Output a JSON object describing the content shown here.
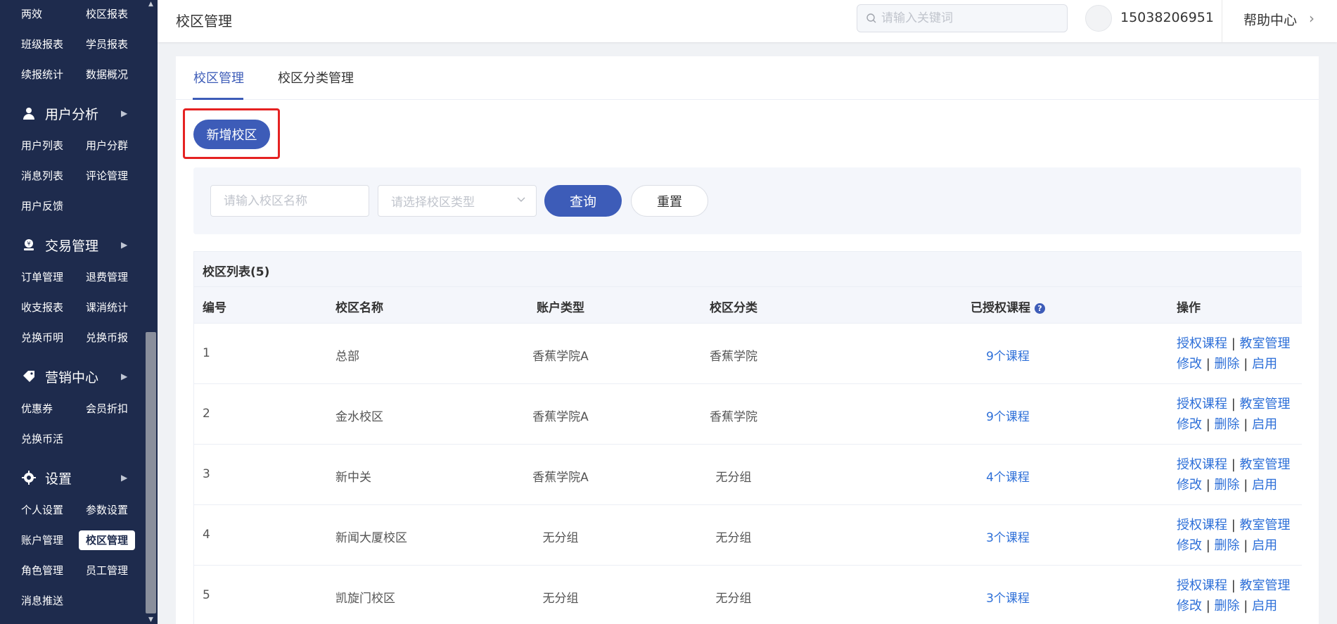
{
  "sidebar": {
    "rows": [
      {
        "left": "两效",
        "right": "校区报表"
      },
      {
        "left": "班级报表",
        "right": "学员报表"
      },
      {
        "left": "续报统计",
        "right": "数据概况"
      }
    ],
    "sections": [
      {
        "label": "用户分析",
        "icon": "user-icon",
        "rows": [
          {
            "left": "用户列表",
            "right": "用户分群"
          },
          {
            "left": "消息列表",
            "right": "评论管理"
          },
          {
            "left": "用户反馈",
            "right": ""
          }
        ]
      },
      {
        "label": "交易管理",
        "icon": "money-icon",
        "rows": [
          {
            "left": "订单管理",
            "right": "退费管理"
          },
          {
            "left": "收支报表",
            "right": "课消统计"
          },
          {
            "left": "兑换币明",
            "right": "兑换币报"
          }
        ]
      },
      {
        "label": "营销中心",
        "icon": "tag-icon",
        "rows": [
          {
            "left": "优惠券",
            "right": "会员折扣"
          },
          {
            "left": "兑换币活",
            "right": ""
          }
        ]
      },
      {
        "label": "设置",
        "icon": "gear-icon",
        "rows": [
          {
            "left": "个人设置",
            "right": "参数设置"
          },
          {
            "left": "账户管理",
            "right": "校区管理"
          },
          {
            "left": "角色管理",
            "right": "员工管理"
          },
          {
            "left": "消息推送",
            "right": ""
          }
        ]
      }
    ],
    "active_item": "校区管理"
  },
  "header": {
    "title": "校区管理",
    "search_placeholder": "请输入关键词",
    "phone": "15038206951",
    "help": "帮助中心"
  },
  "tabs": [
    {
      "label": "校区管理",
      "active": true
    },
    {
      "label": "校区分类管理",
      "active": false
    }
  ],
  "add_button": "新增校区",
  "filter": {
    "name_placeholder": "请输入校区名称",
    "type_placeholder": "请选择校区类型",
    "query": "查询",
    "reset": "重置"
  },
  "table": {
    "title": "校区列表(5)",
    "columns": [
      "编号",
      "校区名称",
      "账户类型",
      "校区分类",
      "已授权课程",
      "操作"
    ],
    "help_mark": "?",
    "rows": [
      {
        "id": "1",
        "name": "总部",
        "account_type": "香蕉学院A",
        "category": "香蕉学院",
        "courses": "9个课程"
      },
      {
        "id": "2",
        "name": "金水校区",
        "account_type": "香蕉学院A",
        "category": "香蕉学院",
        "courses": "9个课程"
      },
      {
        "id": "3",
        "name": "新中关",
        "account_type": "香蕉学院A",
        "category": "无分组",
        "courses": "4个课程"
      },
      {
        "id": "4",
        "name": "新闻大厦校区",
        "account_type": "无分组",
        "category": "无分组",
        "courses": "3个课程"
      },
      {
        "id": "5",
        "name": "凯旋门校区",
        "account_type": "无分组",
        "category": "无分组",
        "courses": "3个课程"
      }
    ],
    "ops": {
      "authorize": "授权课程",
      "classroom": "教室管理",
      "edit": "修改",
      "delete": "删除",
      "enable": "启用",
      "separator": "|"
    }
  },
  "colors": {
    "sidebar_bg": "#1e2b4d",
    "primary": "#3d5cb8",
    "link": "#2d6fd8",
    "highlight": "#e52222"
  }
}
